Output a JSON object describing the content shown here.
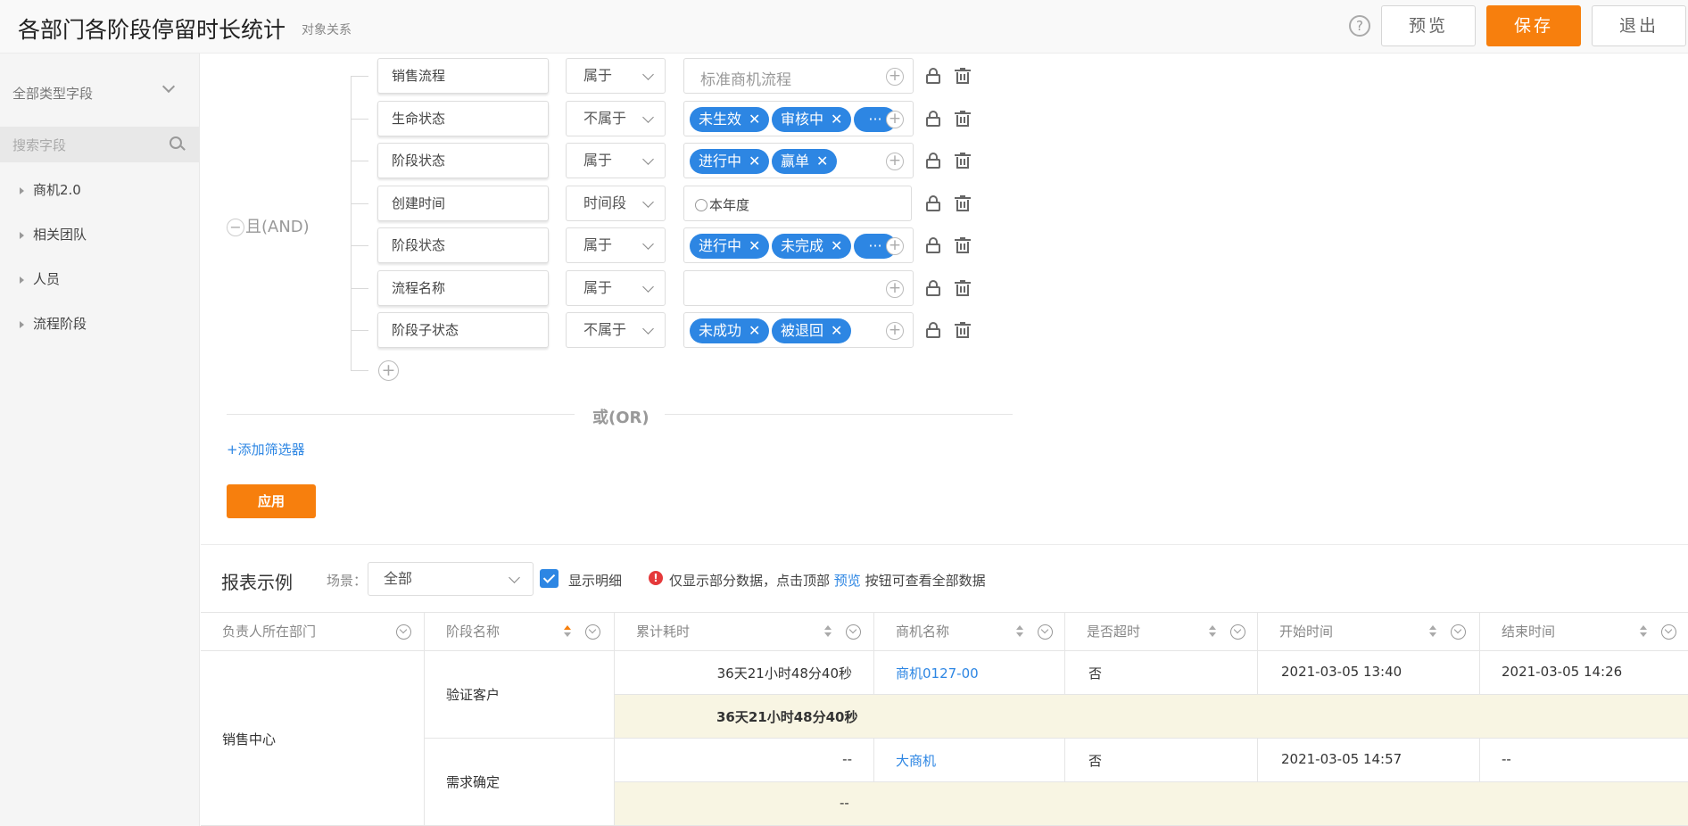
{
  "header": {
    "title": "各部门各阶段停留时长统计",
    "subtitle": "对象关系",
    "help_icon": "?",
    "preview_label": "预览",
    "save_label": "保存",
    "exit_label": "退出"
  },
  "sidebar": {
    "type_select": "全部类型字段",
    "search_placeholder": "搜索字段",
    "items": [
      {
        "label": "商机2.0"
      },
      {
        "label": "相关团队"
      },
      {
        "label": "人员"
      },
      {
        "label": "流程阶段"
      }
    ]
  },
  "filter": {
    "and_label": "且(AND)",
    "minus_symbol": "−",
    "add_symbol": "+",
    "or_label": "或(OR)",
    "add_filter_label": "+添加筛选器",
    "apply_label": "应用",
    "ellipsis": "···",
    "remove_symbol": "✕",
    "conditions": [
      {
        "field": "销售流程",
        "operator": "属于",
        "value_text": "标准商机流程",
        "tags": []
      },
      {
        "field": "生命状态",
        "operator": "不属于",
        "value_text": "",
        "tags": [
          "未生效",
          "审核中"
        ],
        "more": true
      },
      {
        "field": "阶段状态",
        "operator": "属于",
        "value_text": "",
        "tags": [
          "进行中",
          "赢单"
        ]
      },
      {
        "field": "创建时间",
        "operator": "时间段",
        "value_text": "本年度",
        "tags": []
      },
      {
        "field": "阶段状态",
        "operator": "属于",
        "value_text": "",
        "tags": [
          "进行中",
          "未完成"
        ],
        "more": true
      },
      {
        "field": "流程名称",
        "operator": "属于",
        "value_text": "",
        "tags": []
      },
      {
        "field": "阶段子状态",
        "operator": "不属于",
        "value_text": "",
        "tags": [
          "未成功",
          "被退回"
        ]
      }
    ]
  },
  "report": {
    "title": "报表示例",
    "scene_label": "场景：",
    "scene_value": "全部",
    "show_detail_label": "显示明细",
    "show_detail_checked": true,
    "notice_icon": "!",
    "notice_prefix": "仅显示部分数据，点击顶部",
    "notice_link": "预览",
    "notice_suffix": "按钮可查看全部数据",
    "columns": [
      "负责人所在部门",
      "阶段名称",
      "累计耗时",
      "商机名称",
      "是否超时",
      "开始时间",
      "结束时间"
    ],
    "department": "销售中心",
    "groups": [
      {
        "stage": "验证客户",
        "row": {
          "duration": "36天21小时48分40秒",
          "opportunity": "商机0127-00",
          "overdue": "否",
          "start": "2021-03-05 13:40",
          "end": "2021-03-05 14:26"
        },
        "subtotal": "36天21小时48分40秒"
      },
      {
        "stage": "需求确定",
        "row": {
          "duration": "--",
          "opportunity": "大商机",
          "overdue": "否",
          "start": "2021-03-05 14:57",
          "end": "--"
        },
        "subtotal": "--"
      }
    ]
  }
}
